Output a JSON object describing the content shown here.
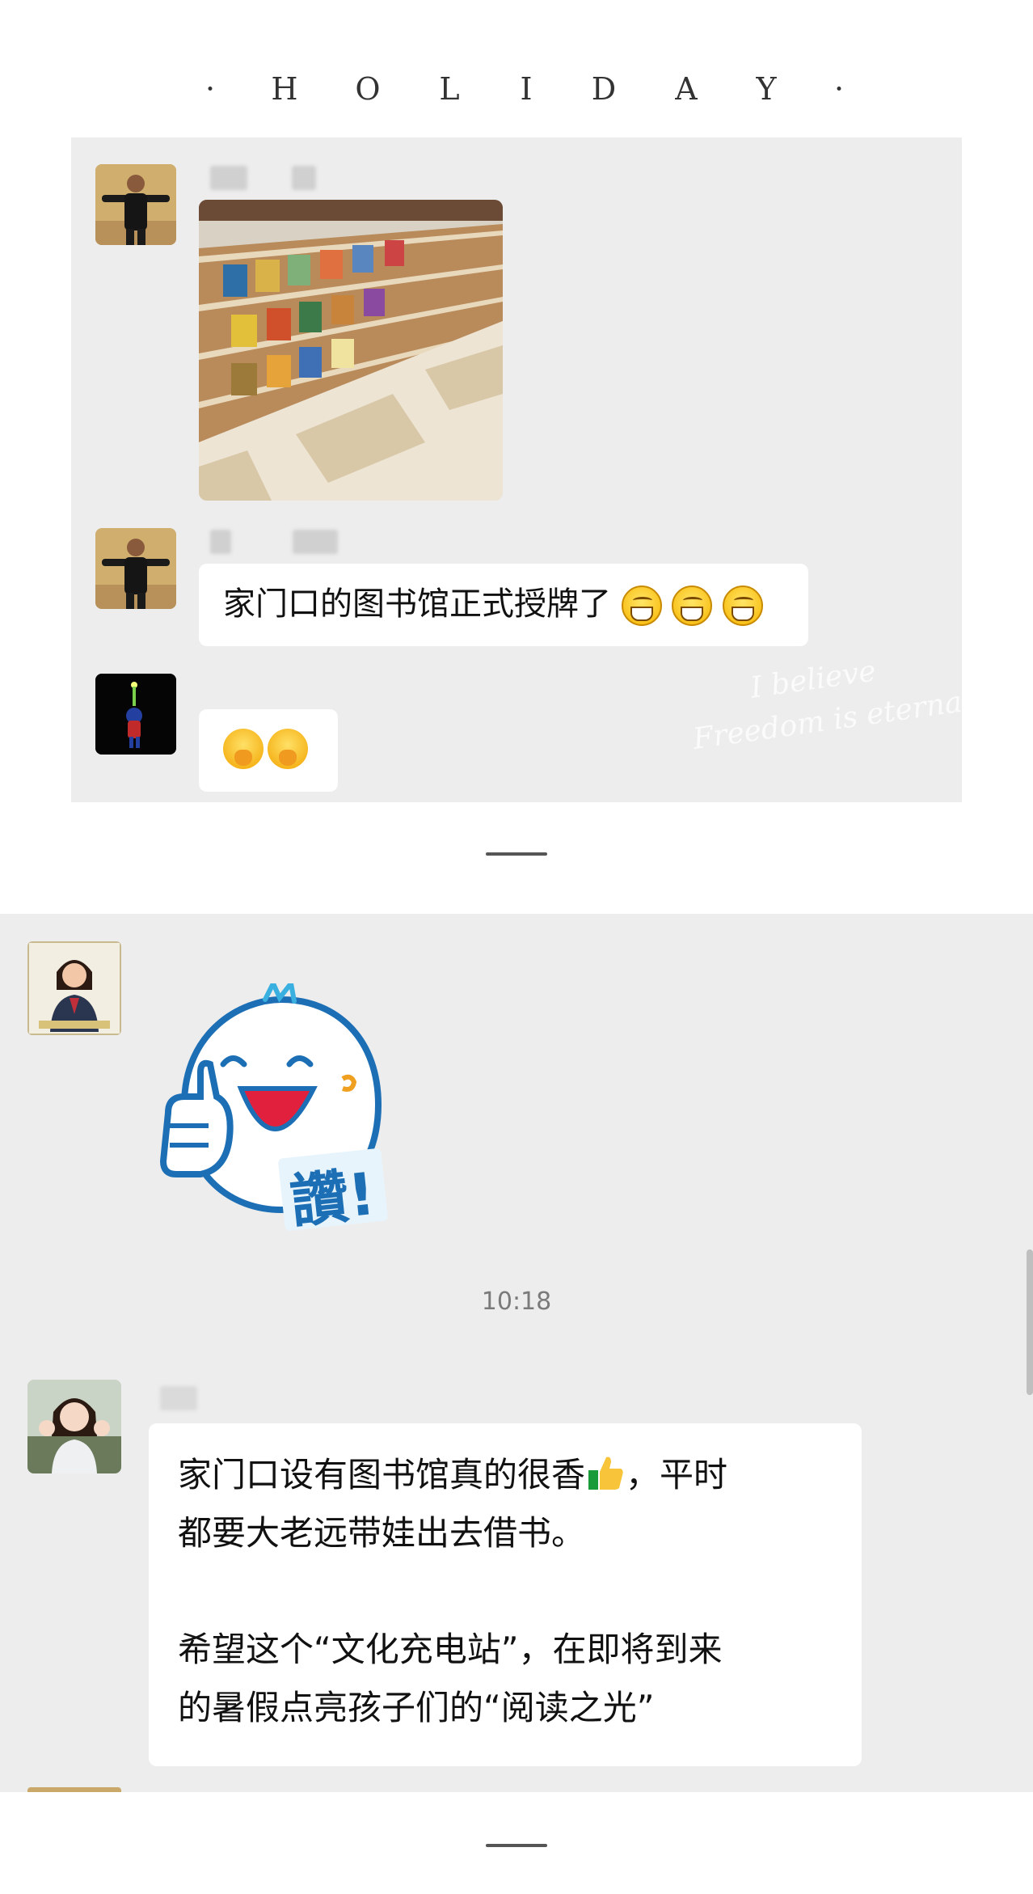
{
  "header": {
    "dot_left": "·",
    "letters": [
      "H",
      "O",
      "L",
      "I",
      "D",
      "A",
      "Y"
    ],
    "dot_right": "·"
  },
  "chat1": {
    "message_text": "家门口的图书馆正式授牌了",
    "watermark_line1": "I believe",
    "watermark_line2": "Freedom is eternal"
  },
  "chat2": {
    "sticker_text": "讚!",
    "timestamp": "10:18",
    "message_line1": "家门口设有图书馆真的很香",
    "message_line1_end": "，平时",
    "message_line2": "都要大老远带娃出去借书。",
    "message_line3": "希望这个“文化充电站”，在即将到来",
    "message_line4": "的暑假点亮孩子们的“阅读之光”"
  },
  "icons": {
    "grin": "grinning-face-emoji-icon",
    "shush": "shushing-face-emoji-icon",
    "thumbs": "thumbs-up-emoji-icon"
  }
}
